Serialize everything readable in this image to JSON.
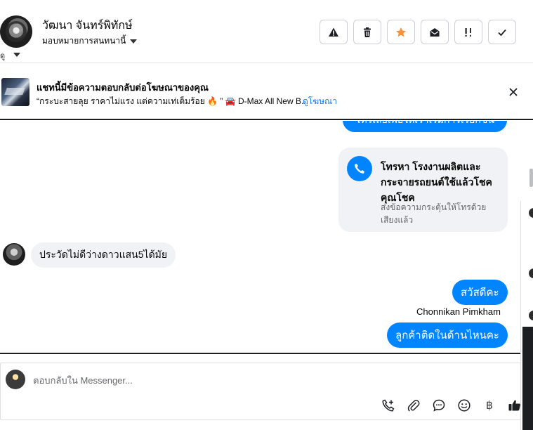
{
  "header": {
    "contact_name": "วัฒนา จันทร์พิทักษ์",
    "assign_label": "มอบหมายการสนทนานี้",
    "left_edge_label": "ดู",
    "action_icons": [
      "alert-triangle-icon",
      "trash-icon",
      "star-icon",
      "open-envelope-icon",
      "priority-icon",
      "check-icon"
    ]
  },
  "ad_banner": {
    "title": "แชทนี้มีข้อความตอบกลับต่อโฆษณาของคุณ",
    "description": "“กระบะสายลุย ราคาไม่แรง แต่ความเท่เต็มร้อย 🔥 ” 🚘 D-Max All New B...",
    "view_ad_link": "ดูโฆษณา"
  },
  "conversation": {
    "cut_bubble_text": "โทรเลยเพื่อให้เราเริ่มการเรียกขึ้น",
    "call_card": {
      "title": "โทรหา โรงงานผลิตและกระจายรถยนต์ใช้แล้วโชคคุณโชค",
      "subtitle": "ส่งข้อความกระตุ้นให้โทรด้วยเสียงแล้ว"
    },
    "incoming_message": "ประวัดไม่ดีว่างดาวแสน5ได้มัย",
    "outgoing_hello": "สวัสดีคะ",
    "sender_name": "Chonnikan Pimkham",
    "outgoing_where": "ลูกค้าติดในด้านไหนคะ"
  },
  "composer": {
    "placeholder": "ตอบกลับใน Messenger...",
    "baht_symbol": "฿",
    "tool_icons": [
      "call-request-icon",
      "attachment-icon",
      "saved-reply-icon",
      "emoji-icon",
      "baht-icon",
      "thumbs-up-icon"
    ]
  },
  "colors": {
    "messenger_blue": "#0084ff",
    "link_blue": "#1877f2",
    "bubble_gray": "#f0f2f5",
    "star_orange": "#f7923b"
  }
}
